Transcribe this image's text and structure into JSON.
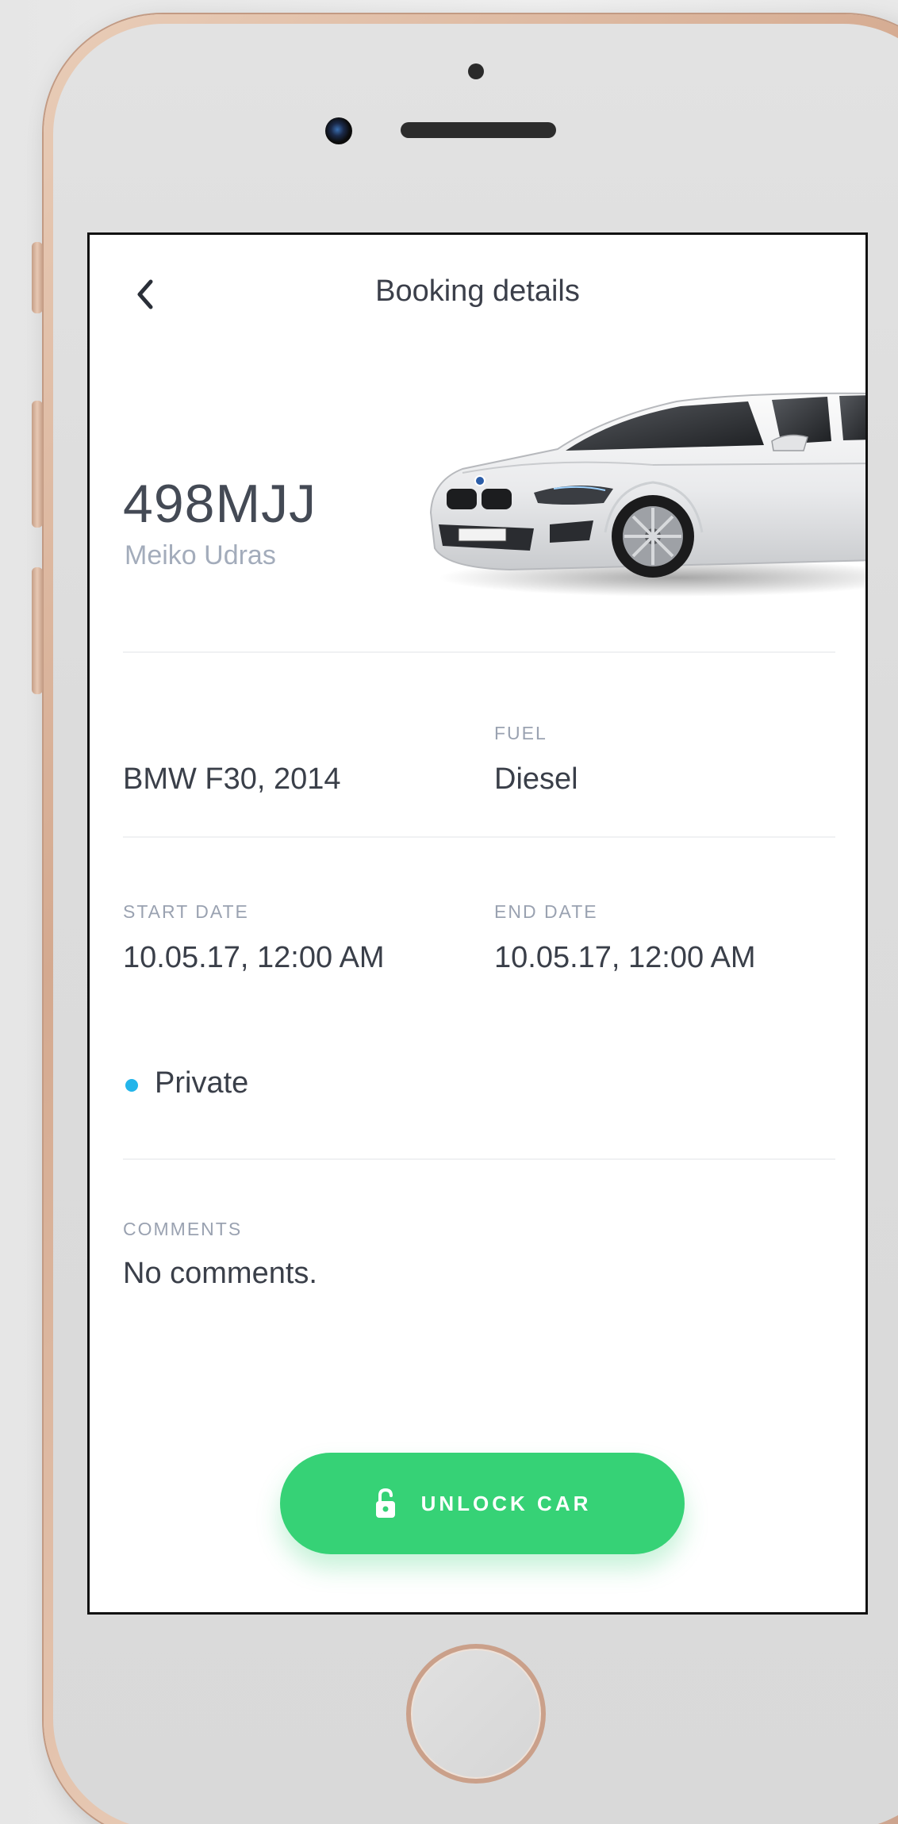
{
  "header": {
    "title": "Booking details",
    "back_icon": "chevron-left-icon"
  },
  "vehicle": {
    "plate": "498MJJ",
    "owner": "Meiko Udras",
    "model": "BMW F30, 2014",
    "image": "white-bmw-sedan"
  },
  "fuel": {
    "label": "FUEL",
    "value": "Diesel"
  },
  "dates": {
    "start_label": "START DATE",
    "start_value": "10.05.17, 12:00 AM",
    "end_label": "END DATE",
    "end_value": "10.05.17, 12:00 AM"
  },
  "booking_type": {
    "label": "Private",
    "dot_color": "#23b5ea"
  },
  "comments": {
    "label": "COMMENTS",
    "value": "No comments."
  },
  "action": {
    "label": "UNLOCK CAR",
    "icon": "unlock-icon",
    "color": "#36d276"
  }
}
